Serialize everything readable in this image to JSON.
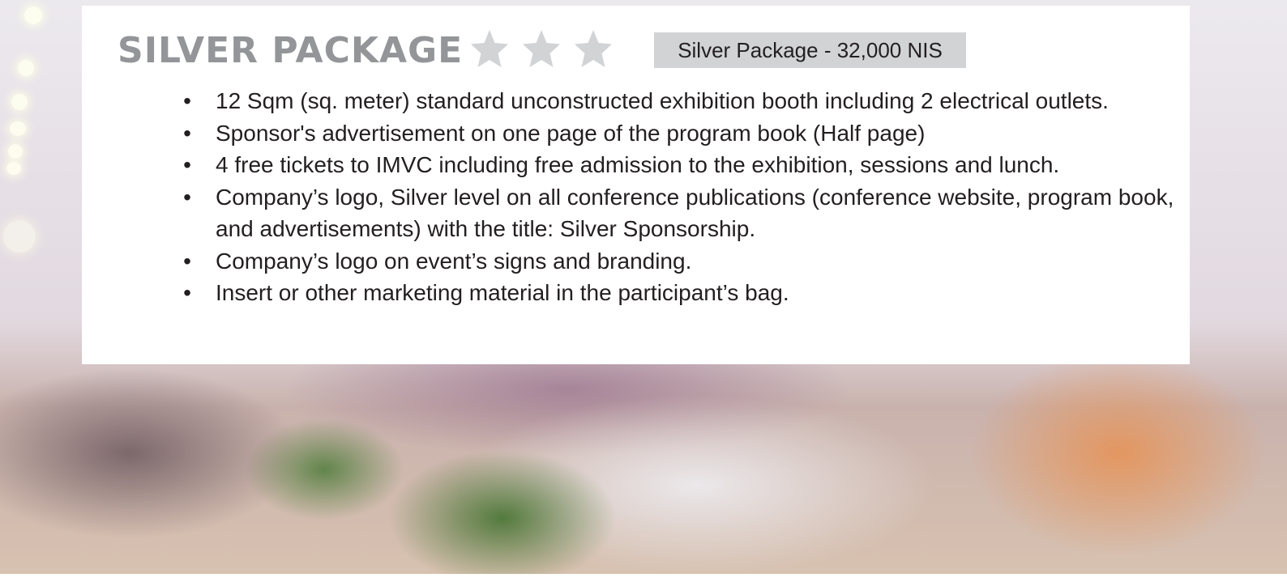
{
  "header": {
    "title": "SILVER PACKAGE",
    "rating_stars": 3,
    "price_label": "Silver Package - 32,000 NIS"
  },
  "features": [
    "12 Sqm (sq. meter) standard unconstructed exhibition booth including 2 electrical outlets.",
    "Sponsor's advertisement on one page of the program book (Half page)",
    "4 free tickets to IMVC including free admission to the exhibition, sessions and lunch.",
    "Company’s logo, Silver level on all conference publications (conference website, program book, and advertisements) with the title: Silver Sponsorship.",
    "Company’s logo on event’s signs and branding.",
    "Insert or other marketing material in the participant’s bag."
  ],
  "bullet_glyph": "•",
  "colors": {
    "title": "#939598",
    "star": "#d1d3d4",
    "badge_background": "#d1d3d4",
    "text": "#231f20",
    "panel": "#ffffff"
  }
}
